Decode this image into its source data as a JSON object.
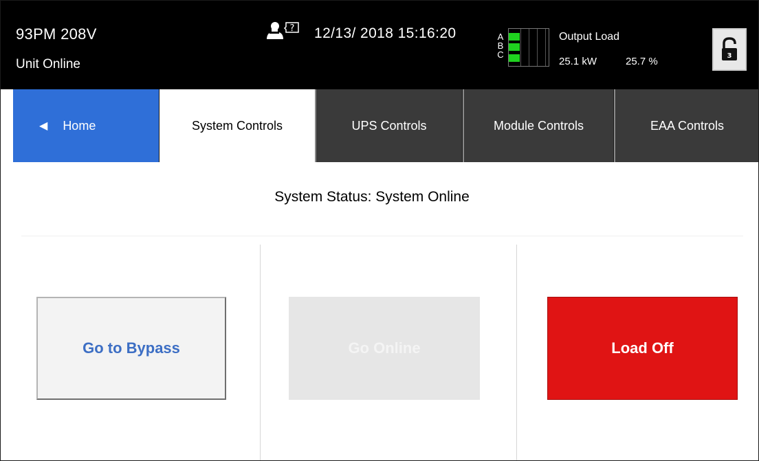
{
  "header": {
    "model": "93PM 208V",
    "unit_status": "Unit Online",
    "help_icon": "user-help-icon",
    "datetime": "12/13/ 2018 15:16:20",
    "phases": [
      "A",
      "B",
      "C"
    ],
    "phase_fill_color": "#1fd21f",
    "output_load_label": "Output Load",
    "output_kw": "25.1 kW",
    "output_pct": "25.7 %",
    "lock_icon": "unlocked-padlock-icon",
    "lock_level": "3"
  },
  "tabs": {
    "home": "Home",
    "system": "System Controls",
    "ups": "UPS Controls",
    "module": "Module Controls",
    "eaa": "EAA Controls",
    "active": "System Controls",
    "home_color": "#2f6fd8",
    "inactive_color": "#3a3a3a"
  },
  "main": {
    "system_status": "System Status: System Online",
    "buttons": {
      "go_bypass": "Go to Bypass",
      "go_online": "Go Online",
      "load_off": "Load Off"
    },
    "load_off_color": "#e01414",
    "bypass_text_color": "#3c6ec4"
  }
}
